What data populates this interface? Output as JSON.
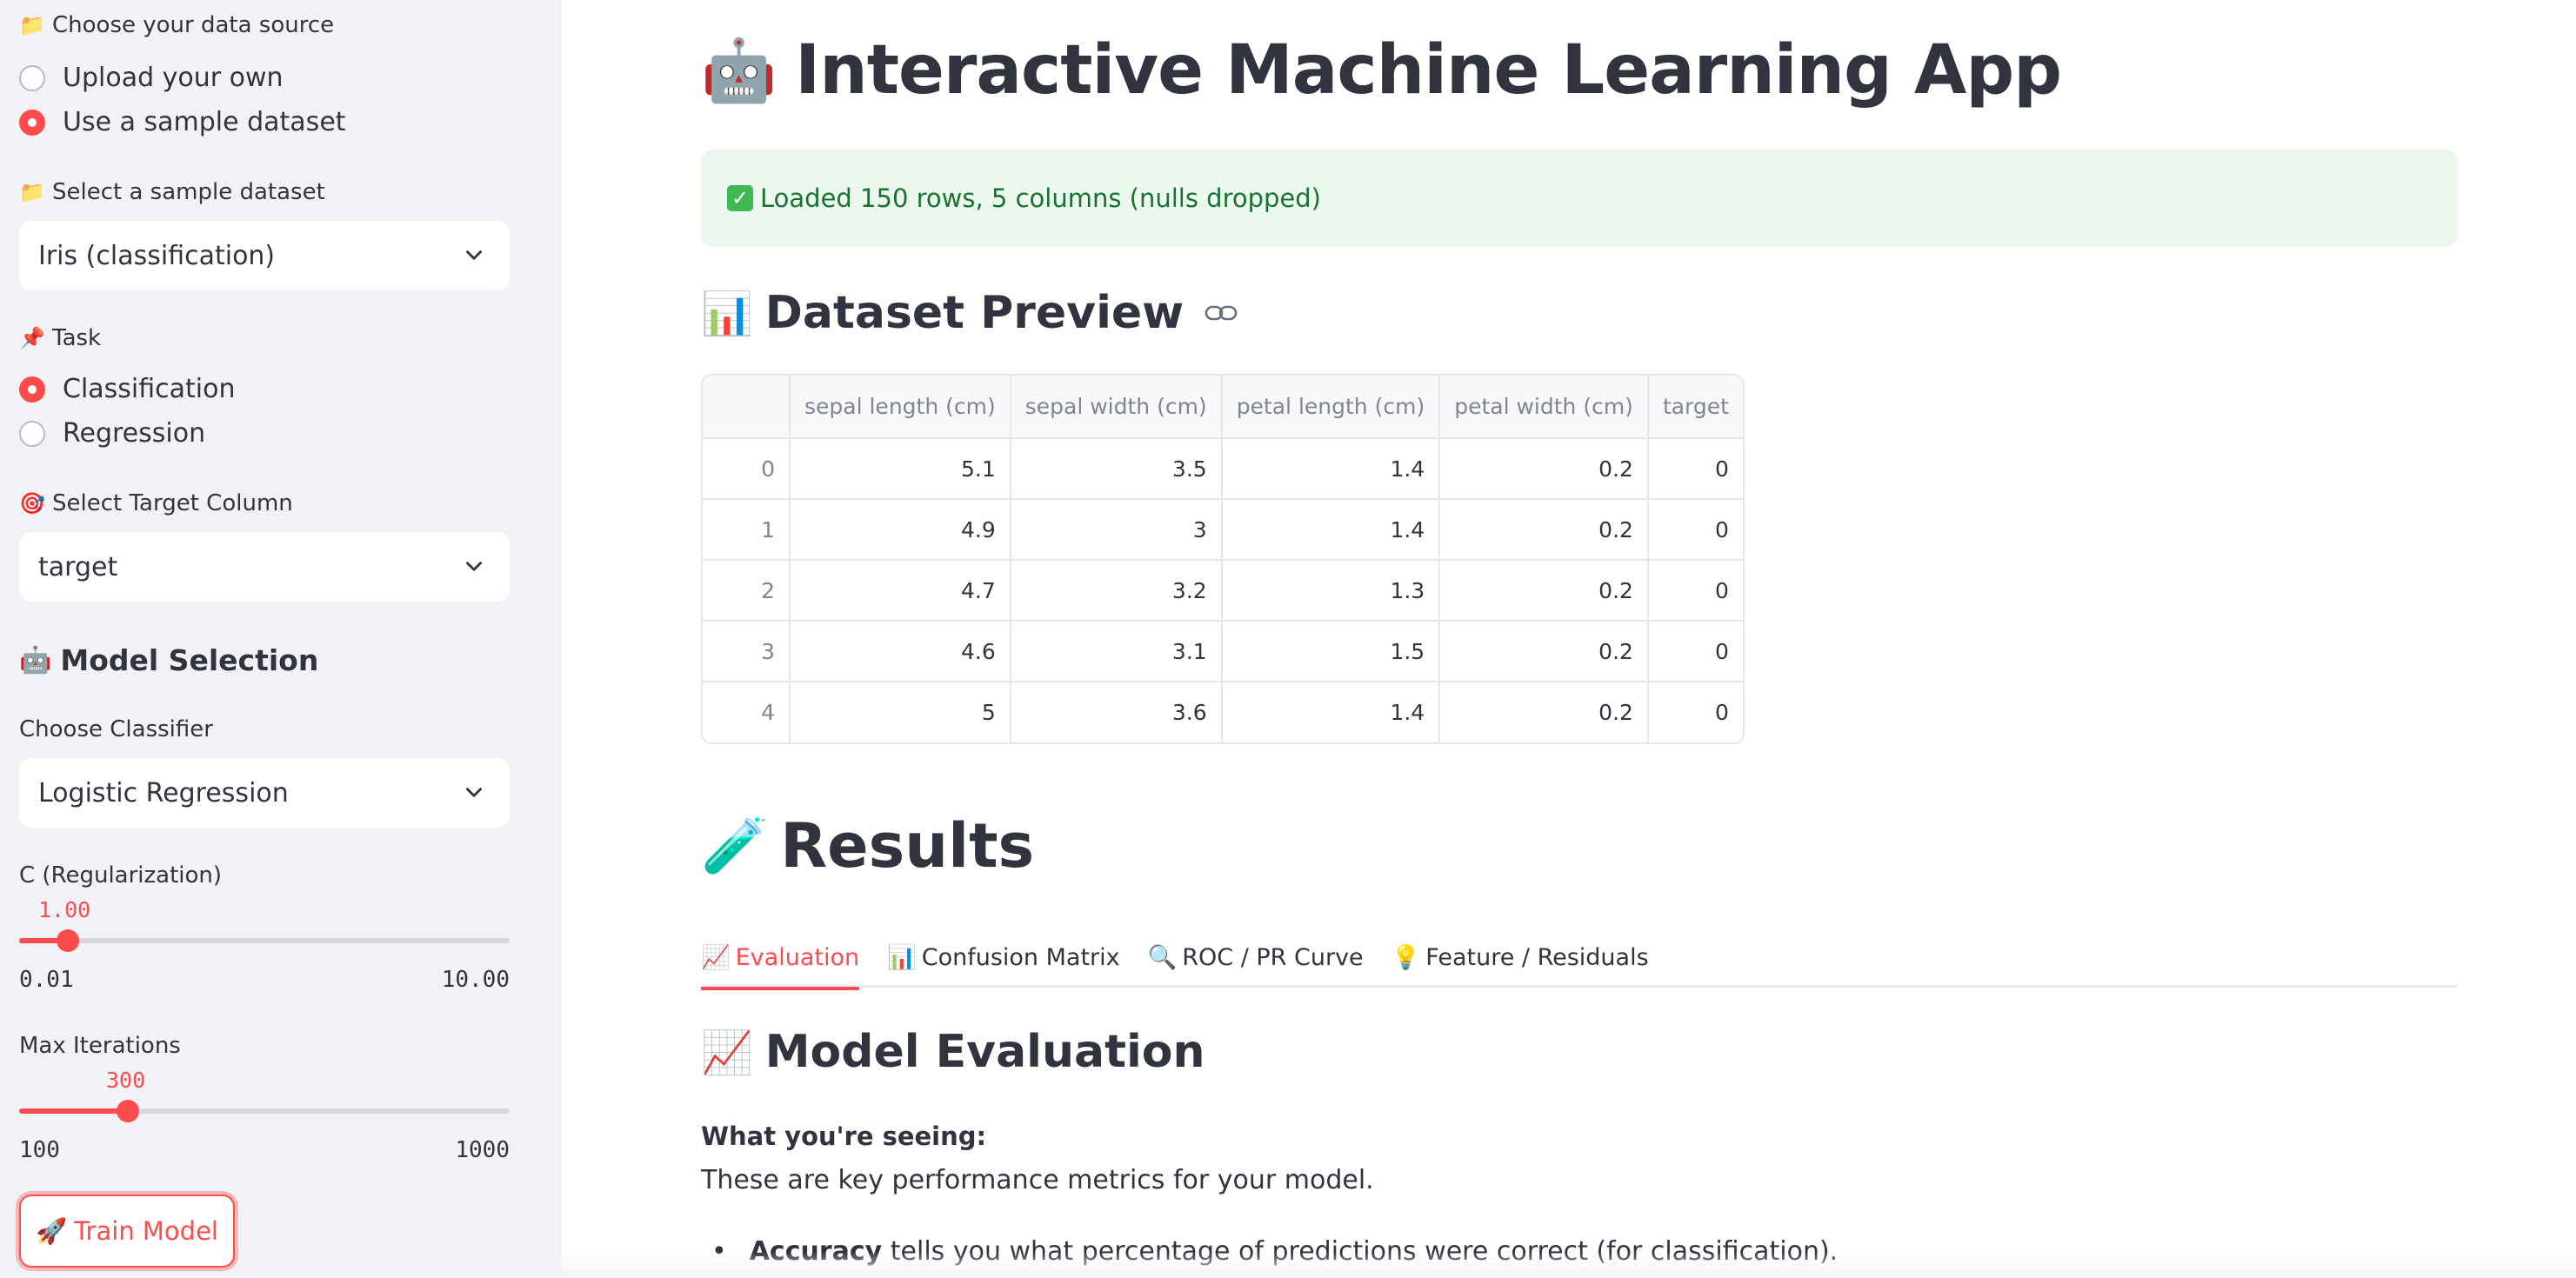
{
  "sidebar": {
    "data_source": {
      "label": "Choose your data source",
      "options": [
        "Upload your own",
        "Use a sample dataset"
      ],
      "selected": "Use a sample dataset"
    },
    "sample_dataset": {
      "label": "Select a sample dataset",
      "value": "Iris (classification)"
    },
    "task": {
      "label": "Task",
      "options": [
        "Classification",
        "Regression"
      ],
      "selected": "Classification"
    },
    "target": {
      "label": "Select Target Column",
      "value": "target"
    },
    "model_selection": {
      "heading": "Model Selection"
    },
    "classifier": {
      "label": "Choose Classifier",
      "value": "Logistic Regression"
    },
    "c_slider": {
      "label": "C (Regularization)",
      "value": "1.00",
      "min": "0.01",
      "max": "10.00",
      "fraction": 0.1
    },
    "iter_slider": {
      "label": "Max Iterations",
      "value": "300",
      "min": "100",
      "max": "1000",
      "fraction": 0.222
    },
    "train_button": "Train Model"
  },
  "main": {
    "title": "Interactive Machine Learning App",
    "alert": "Loaded 150 rows, 5 columns (nulls dropped)",
    "preview_heading": "Dataset Preview",
    "table": {
      "columns": [
        "",
        "sepal length (cm)",
        "sepal width (cm)",
        "petal length (cm)",
        "petal width (cm)",
        "target"
      ],
      "rows": [
        [
          "0",
          "5.1",
          "3.5",
          "1.4",
          "0.2",
          "0"
        ],
        [
          "1",
          "4.9",
          "3",
          "1.4",
          "0.2",
          "0"
        ],
        [
          "2",
          "4.7",
          "3.2",
          "1.3",
          "0.2",
          "0"
        ],
        [
          "3",
          "4.6",
          "3.1",
          "1.5",
          "0.2",
          "0"
        ],
        [
          "4",
          "5",
          "3.6",
          "1.4",
          "0.2",
          "0"
        ]
      ]
    },
    "results_heading": "Results",
    "tabs": [
      {
        "icon": "chart-up-icon",
        "label": "Evaluation",
        "active": true
      },
      {
        "icon": "bar-chart-icon",
        "label": "Confusion Matrix",
        "active": false
      },
      {
        "icon": "magnifier-icon",
        "label": "ROC / PR Curve",
        "active": false
      },
      {
        "icon": "lightbulb-icon",
        "label": "Feature / Residuals",
        "active": false
      }
    ],
    "evaluation_heading": "Model Evaluation",
    "seeing_label": "What you're seeing:",
    "seeing_text": "These are key performance metrics for your model.",
    "bullet_bold": "Accuracy",
    "bullet_text": "tells you what percentage of predictions were correct (for classification)."
  },
  "colors": {
    "accent": "#ff4b4b",
    "sidebar_bg": "#f0f2f6",
    "success_bg": "#ecf8ee",
    "success_text": "#177233"
  }
}
